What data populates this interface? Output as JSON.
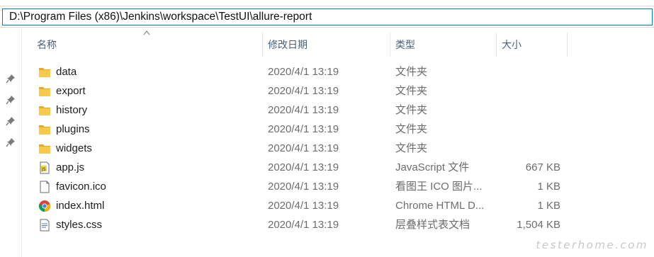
{
  "address_bar": {
    "path": "D:\\Program Files (x86)\\Jenkins\\workspace\\TestUI\\allure-report"
  },
  "columns": {
    "name": "名称",
    "date_modified": "修改日期",
    "type": "类型",
    "size": "大小"
  },
  "files": [
    {
      "name": "data",
      "date": "2020/4/1 13:19",
      "type": "文件夹",
      "size": "",
      "icon": "folder-icon"
    },
    {
      "name": "export",
      "date": "2020/4/1 13:19",
      "type": "文件夹",
      "size": "",
      "icon": "folder-icon"
    },
    {
      "name": "history",
      "date": "2020/4/1 13:19",
      "type": "文件夹",
      "size": "",
      "icon": "folder-icon"
    },
    {
      "name": "plugins",
      "date": "2020/4/1 13:19",
      "type": "文件夹",
      "size": "",
      "icon": "folder-icon"
    },
    {
      "name": "widgets",
      "date": "2020/4/1 13:19",
      "type": "文件夹",
      "size": "",
      "icon": "folder-icon"
    },
    {
      "name": "app.js",
      "date": "2020/4/1 13:19",
      "type": "JavaScript 文件",
      "size": "667 KB",
      "icon": "javascript-file-icon"
    },
    {
      "name": "favicon.ico",
      "date": "2020/4/1 13:19",
      "type": "看图王 ICO 图片...",
      "size": "1 KB",
      "icon": "blank-file-icon"
    },
    {
      "name": "index.html",
      "date": "2020/4/1 13:19",
      "type": "Chrome HTML D...",
      "size": "1 KB",
      "icon": "chrome-icon"
    },
    {
      "name": "styles.css",
      "date": "2020/4/1 13:19",
      "type": "层叠样式表文档",
      "size": "1,504 KB",
      "icon": "css-file-icon"
    }
  ],
  "watermark": "testerhome.com",
  "colors": {
    "folder": "#f7c948",
    "folder_dark": "#e5a92a",
    "header_text": "#4c607a",
    "address_border": "#0078d7"
  }
}
